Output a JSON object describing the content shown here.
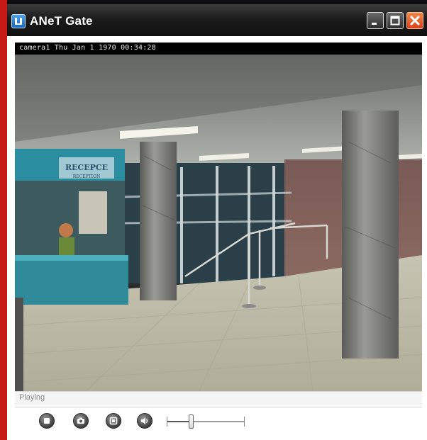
{
  "window": {
    "title": "ANeT Gate"
  },
  "titlebar_buttons": {
    "minimize": "minimize-icon",
    "maximize": "maximize-icon",
    "close": "close-icon"
  },
  "video": {
    "overlay_text": "camera1  Thu Jan 1 1970 00:34:28"
  },
  "status": {
    "text": "Playing"
  },
  "controls": {
    "stop": "stop-icon",
    "snapshot": "camera-icon",
    "fullscreen": "fullscreen-icon",
    "volume": "speaker-icon",
    "volume_level": 0.3
  },
  "colors": {
    "titlebar": "#1c1c1c",
    "close_button": "#d8401a",
    "left_strip": "#c81818"
  }
}
